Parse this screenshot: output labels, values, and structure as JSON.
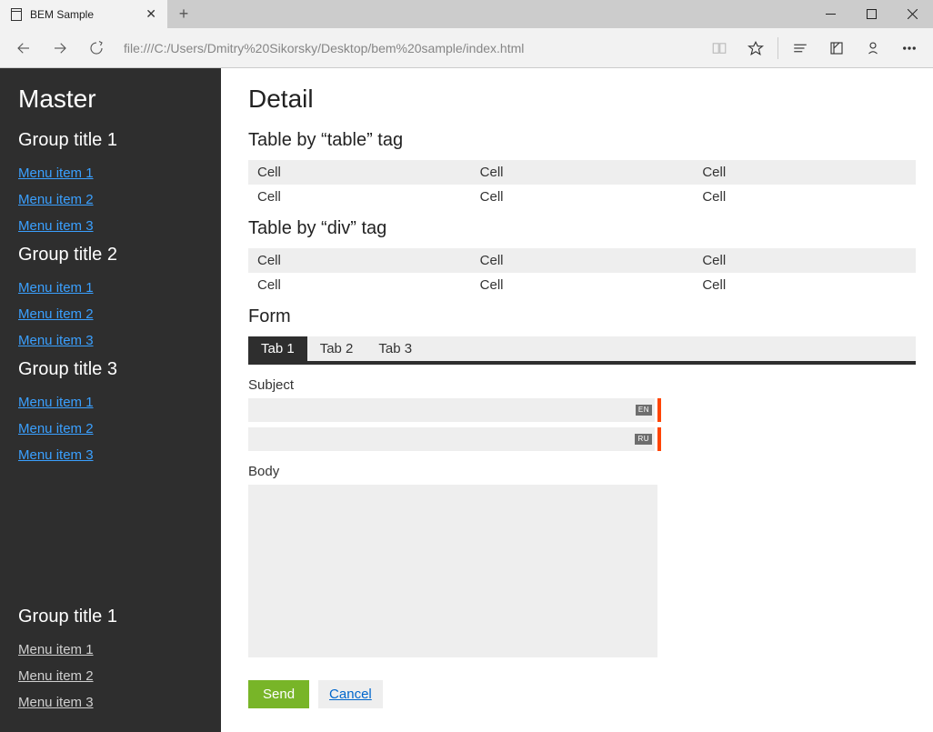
{
  "browser": {
    "tab_title": "BEM Sample",
    "address": "file:///C:/Users/Dmitry%20Sikorsky/Desktop/bem%20sample/index.html"
  },
  "sidebar": {
    "title": "Master",
    "groups_top": [
      {
        "title": "Group title 1",
        "items": [
          "Menu item 1",
          "Menu item 2",
          "Menu item 3"
        ]
      },
      {
        "title": "Group title 2",
        "items": [
          "Menu item 1",
          "Menu item 2",
          "Menu item 3"
        ]
      },
      {
        "title": "Group title 3",
        "items": [
          "Menu item 1",
          "Menu item 2",
          "Menu item 3"
        ]
      }
    ],
    "group_bottom": {
      "title": "Group title 1",
      "items": [
        "Menu item 1",
        "Menu item 2",
        "Menu item 3"
      ]
    }
  },
  "main": {
    "title": "Detail",
    "table1": {
      "heading": "Table by “table” tag",
      "rows": [
        [
          "Cell",
          "Cell",
          "Cell"
        ],
        [
          "Cell",
          "Cell",
          "Cell"
        ]
      ]
    },
    "table2": {
      "heading": "Table by “div” tag",
      "rows": [
        [
          "Cell",
          "Cell",
          "Cell"
        ],
        [
          "Cell",
          "Cell",
          "Cell"
        ]
      ]
    },
    "form": {
      "heading": "Form",
      "tabs": [
        "Tab 1",
        "Tab 2",
        "Tab 3"
      ],
      "active_tab": 0,
      "subject_label": "Subject",
      "subject_langs": [
        "EN",
        "RU"
      ],
      "body_label": "Body",
      "send_label": "Send",
      "cancel_label": "Cancel"
    }
  }
}
